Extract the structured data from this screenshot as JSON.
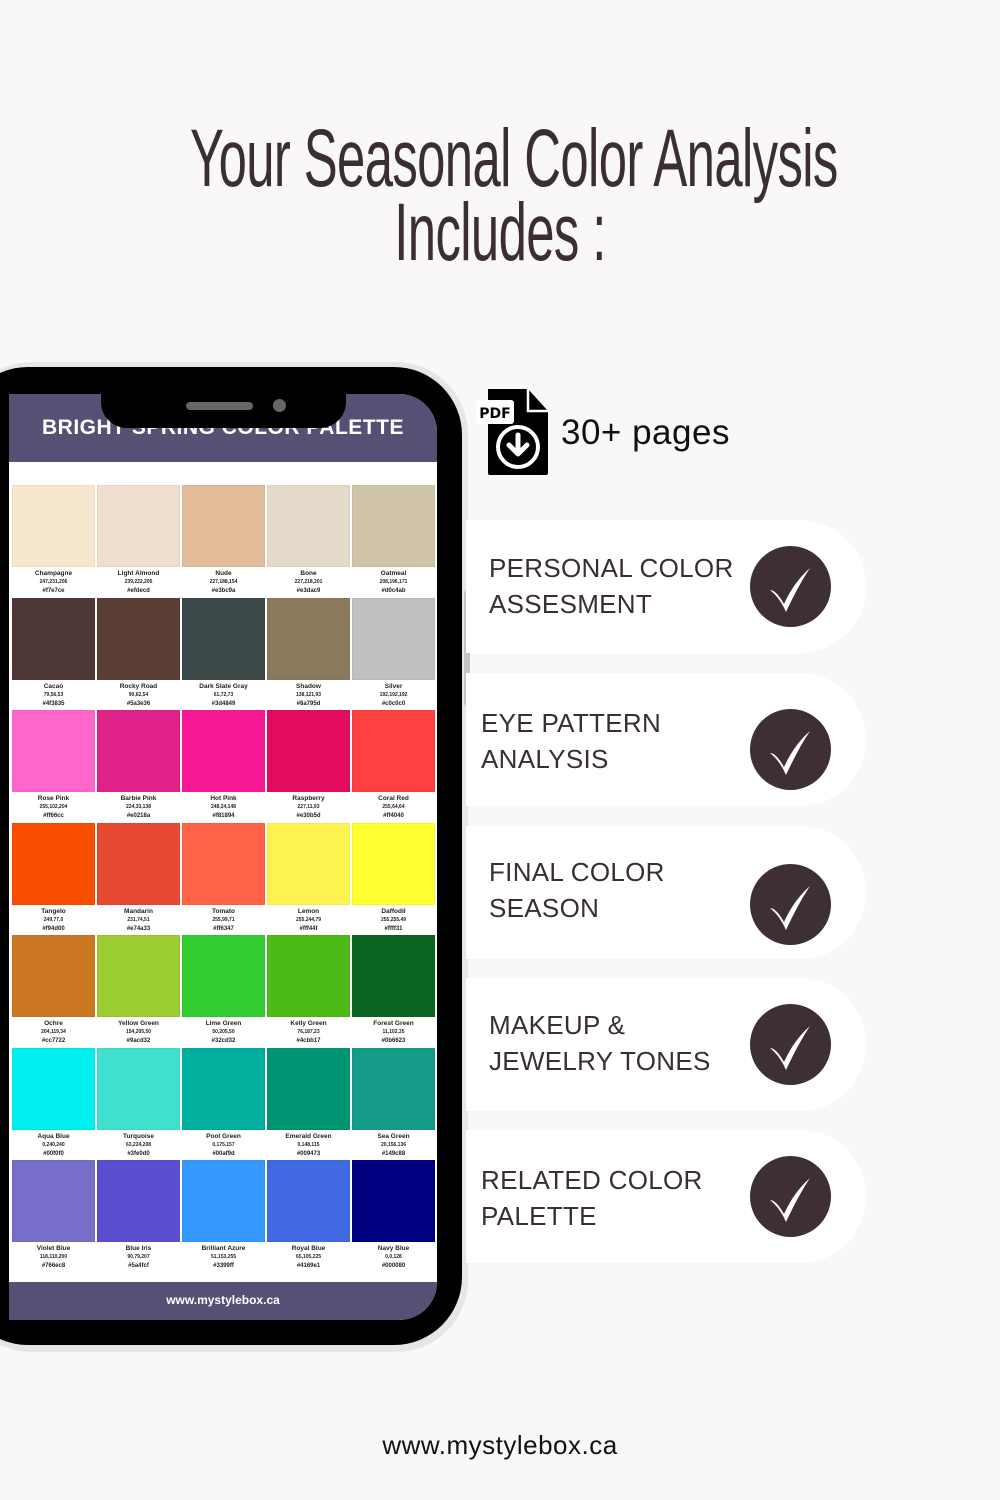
{
  "title": {
    "line1": "Your Seasonal Color Analysis",
    "line2": "Includes :"
  },
  "phone": {
    "screen_title": "BRIGHT SPRING COLOR PALETTE",
    "footer_url": "www.mystylebox.ca",
    "header_color": "#565074",
    "swatches": [
      {
        "name": "Champagne",
        "rgb": "247,231,206",
        "hex": "#f7e7ce"
      },
      {
        "name": "Light Almond",
        "rgb": "239,222,205",
        "hex": "#efdecd"
      },
      {
        "name": "Nude",
        "rgb": "227,188,154",
        "hex": "#e3bc9a"
      },
      {
        "name": "Bone",
        "rgb": "227,218,201",
        "hex": "#e3dac9"
      },
      {
        "name": "Oatmeal",
        "rgb": "208,196,171",
        "hex": "#d0c4ab"
      },
      {
        "name": "Cacao",
        "rgb": "79,56,53",
        "hex": "#4f3835"
      },
      {
        "name": "Rocky Road",
        "rgb": "90,62,54",
        "hex": "#5a3e36"
      },
      {
        "name": "Dark Slate Gray",
        "rgb": "61,72,73",
        "hex": "#3d4849"
      },
      {
        "name": "Shadow",
        "rgb": "138,121,93",
        "hex": "#8a795d"
      },
      {
        "name": "Silver",
        "rgb": "192,192,192",
        "hex": "#c0c0c0"
      },
      {
        "name": "Rose Pink",
        "rgb": "255,102,204",
        "hex": "#ff66cc"
      },
      {
        "name": "Barbie Pink",
        "rgb": "224,33,138",
        "hex": "#e0218a"
      },
      {
        "name": "Hot Pink",
        "rgb": "248,24,148",
        "hex": "#f81894"
      },
      {
        "name": "Raspberry",
        "rgb": "227,11,93",
        "hex": "#e30b5d"
      },
      {
        "name": "Coral Red",
        "rgb": "255,64,64",
        "hex": "#ff4040"
      },
      {
        "name": "Tangelo",
        "rgb": "249,77,0",
        "hex": "#f94d00"
      },
      {
        "name": "Mandarin",
        "rgb": "231,74,51",
        "hex": "#e74a33"
      },
      {
        "name": "Tomato",
        "rgb": "255,99,71",
        "hex": "#ff6347"
      },
      {
        "name": "Lemon",
        "rgb": "255,244,79",
        "hex": "#fff44f"
      },
      {
        "name": "Daffodil",
        "rgb": "255,255,49",
        "hex": "#ffff31"
      },
      {
        "name": "Ochre",
        "rgb": "204,119,34",
        "hex": "#cc7722"
      },
      {
        "name": "Yellow Green",
        "rgb": "154,205,50",
        "hex": "#9acd32"
      },
      {
        "name": "Lime Green",
        "rgb": "50,205,50",
        "hex": "#32cd32"
      },
      {
        "name": "Kelly Green",
        "rgb": "76,187,23",
        "hex": "#4cbb17"
      },
      {
        "name": "Forest Green",
        "rgb": "11,102,35",
        "hex": "#0b6623"
      },
      {
        "name": "Aqua Blue",
        "rgb": "0,240,240",
        "hex": "#00f0f0"
      },
      {
        "name": "Turquoise",
        "rgb": "63,224,208",
        "hex": "#3fe0d0"
      },
      {
        "name": "Pool Green",
        "rgb": "0,175,157",
        "hex": "#00af9d"
      },
      {
        "name": "Emerald Green",
        "rgb": "0,148,115",
        "hex": "#009473"
      },
      {
        "name": "Sea Green",
        "rgb": "20,156,136",
        "hex": "#149c88"
      },
      {
        "name": "Violet Blue",
        "rgb": "118,110,200",
        "hex": "#766ec8"
      },
      {
        "name": "Blue Iris",
        "rgb": "90,79,207",
        "hex": "#5a4fcf"
      },
      {
        "name": "Brilliant Azure",
        "rgb": "51,153,255",
        "hex": "#3399ff"
      },
      {
        "name": "Royal Blue",
        "rgb": "65,105,225",
        "hex": "#4169e1"
      },
      {
        "name": "Navy Blue",
        "rgb": "0,0,128",
        "hex": "#000080"
      }
    ]
  },
  "pdf": {
    "icon": "pdf-download-icon",
    "icon_label": "PDF",
    "pages": "30+ pages"
  },
  "features": [
    {
      "line1": "PERSONAL COLOR",
      "line2": "ASSESMENT",
      "icon": "checkmark-icon"
    },
    {
      "line1": "EYE PATTERN",
      "line2": "ANALYSIS",
      "icon": "checkmark-icon"
    },
    {
      "line1": "FINAL COLOR",
      "line2": "SEASON",
      "icon": "checkmark-icon"
    },
    {
      "line1": "MAKEUP &",
      "line2": "JEWELRY TONES",
      "icon": "checkmark-icon"
    },
    {
      "line1": "RELATED COLOR",
      "line2": "PALETTE",
      "icon": "checkmark-icon"
    }
  ],
  "footer": {
    "url": "www.mystylebox.ca"
  },
  "colors": {
    "background": "#faf8f6",
    "text_dark": "#3a2e31",
    "check_circle": "#3d2f33",
    "phone_accent": "#565074"
  }
}
